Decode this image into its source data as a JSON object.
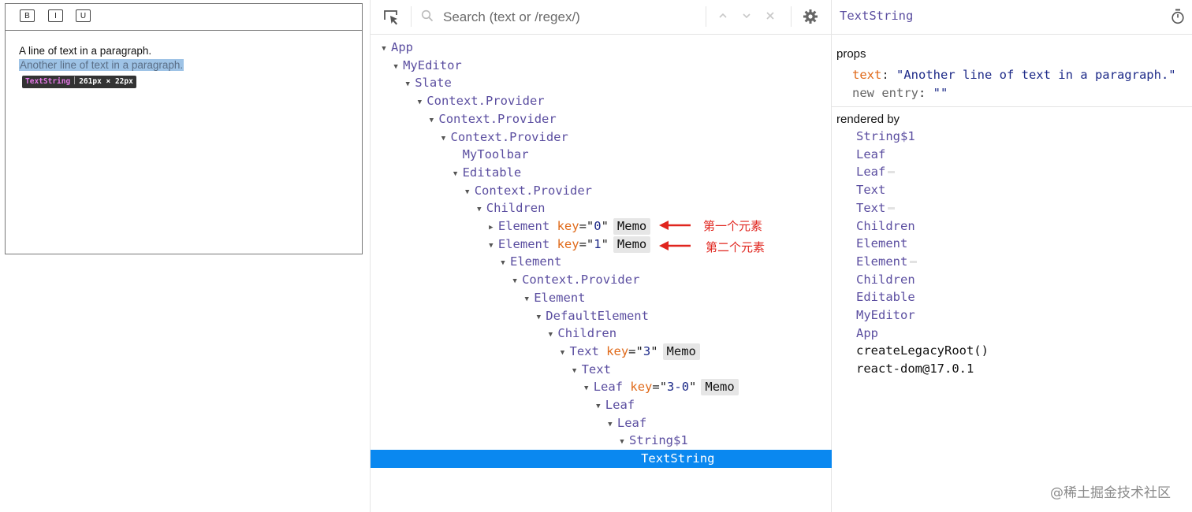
{
  "editor": {
    "toolbar": [
      {
        "label": "B"
      },
      {
        "label": "I"
      },
      {
        "label": "U"
      }
    ],
    "line1": "A line of text in a paragraph.",
    "line2": "Another line of text in a paragraph.",
    "badge": {
      "name": "TextString",
      "size": "261px × 22px"
    }
  },
  "devtools": {
    "search": {
      "placeholder": "Search (text or /regex/)"
    },
    "icons": [
      "inspect-element-icon",
      "search-icon",
      "chevron-up-icon",
      "chevron-down-icon",
      "close-icon",
      "gear-icon",
      "timer-icon"
    ],
    "tree": [
      {
        "depth": 0,
        "arrow": "down",
        "name": "App"
      },
      {
        "depth": 1,
        "arrow": "down",
        "name": "MyEditor"
      },
      {
        "depth": 2,
        "arrow": "down",
        "name": "Slate"
      },
      {
        "depth": 3,
        "arrow": "down",
        "name": "Context.Provider"
      },
      {
        "depth": 4,
        "arrow": "down",
        "name": "Context.Provider"
      },
      {
        "depth": 5,
        "arrow": "down",
        "name": "Context.Provider"
      },
      {
        "depth": 6,
        "arrow": "none",
        "name": "MyToolbar"
      },
      {
        "depth": 6,
        "arrow": "down",
        "name": "Editable"
      },
      {
        "depth": 7,
        "arrow": "down",
        "name": "Context.Provider"
      },
      {
        "depth": 8,
        "arrow": "down",
        "name": "Children"
      },
      {
        "depth": 9,
        "arrow": "right",
        "name": "Element",
        "key": "0",
        "memo": "Memo"
      },
      {
        "depth": 9,
        "arrow": "down",
        "name": "Element",
        "key": "1",
        "memo": "Memo"
      },
      {
        "depth": 10,
        "arrow": "down",
        "name": "Element"
      },
      {
        "depth": 11,
        "arrow": "down",
        "name": "Context.Provider"
      },
      {
        "depth": 12,
        "arrow": "down",
        "name": "Element"
      },
      {
        "depth": 13,
        "arrow": "down",
        "name": "DefaultElement"
      },
      {
        "depth": 14,
        "arrow": "down",
        "name": "Children"
      },
      {
        "depth": 15,
        "arrow": "down",
        "name": "Text",
        "key": "3",
        "memo": "Memo"
      },
      {
        "depth": 16,
        "arrow": "down",
        "name": "Text"
      },
      {
        "depth": 17,
        "arrow": "down",
        "name": "Leaf",
        "key": "3-0",
        "memo": "Memo"
      },
      {
        "depth": 18,
        "arrow": "down",
        "name": "Leaf"
      },
      {
        "depth": 19,
        "arrow": "down",
        "name": "Leaf"
      },
      {
        "depth": 20,
        "arrow": "down",
        "name": "String$1"
      },
      {
        "depth": 21,
        "arrow": "none",
        "name": "TextString",
        "selected": true
      }
    ],
    "annotations": [
      {
        "text": "第一个元素"
      },
      {
        "text": "第二个元素"
      }
    ],
    "inspector": {
      "selected_name": "TextString",
      "props_title": "props",
      "prop_key": "text",
      "prop_value": "\"Another line of text in a paragraph.\"",
      "new_entry_label": "new entry",
      "new_entry_value": "\"\"",
      "rendered_by_title": "rendered by",
      "rendered_by": [
        {
          "name": "String$1",
          "type": "comp"
        },
        {
          "name": "Leaf",
          "type": "comp"
        },
        {
          "name": "Leaf",
          "type": "comp",
          "hoc": true
        },
        {
          "name": "Text",
          "type": "comp"
        },
        {
          "name": "Text",
          "type": "comp",
          "hoc": true
        },
        {
          "name": "Children",
          "type": "comp"
        },
        {
          "name": "Element",
          "type": "comp"
        },
        {
          "name": "Element",
          "type": "comp",
          "hoc": true
        },
        {
          "name": "Children",
          "type": "comp"
        },
        {
          "name": "Editable",
          "type": "comp"
        },
        {
          "name": "MyEditor",
          "type": "comp"
        },
        {
          "name": "App",
          "type": "comp"
        },
        {
          "name": "createLegacyRoot()",
          "type": "plain"
        },
        {
          "name": "react-dom@17.0.1",
          "type": "plain"
        }
      ]
    }
  },
  "watermark": "@稀土掘金技术社区",
  "colors": {
    "selected_row": "#0a88f0",
    "component": "#5b4ea0",
    "key": "#e06a1a",
    "value": "#1d2a88",
    "annotation": "#e0251e"
  }
}
